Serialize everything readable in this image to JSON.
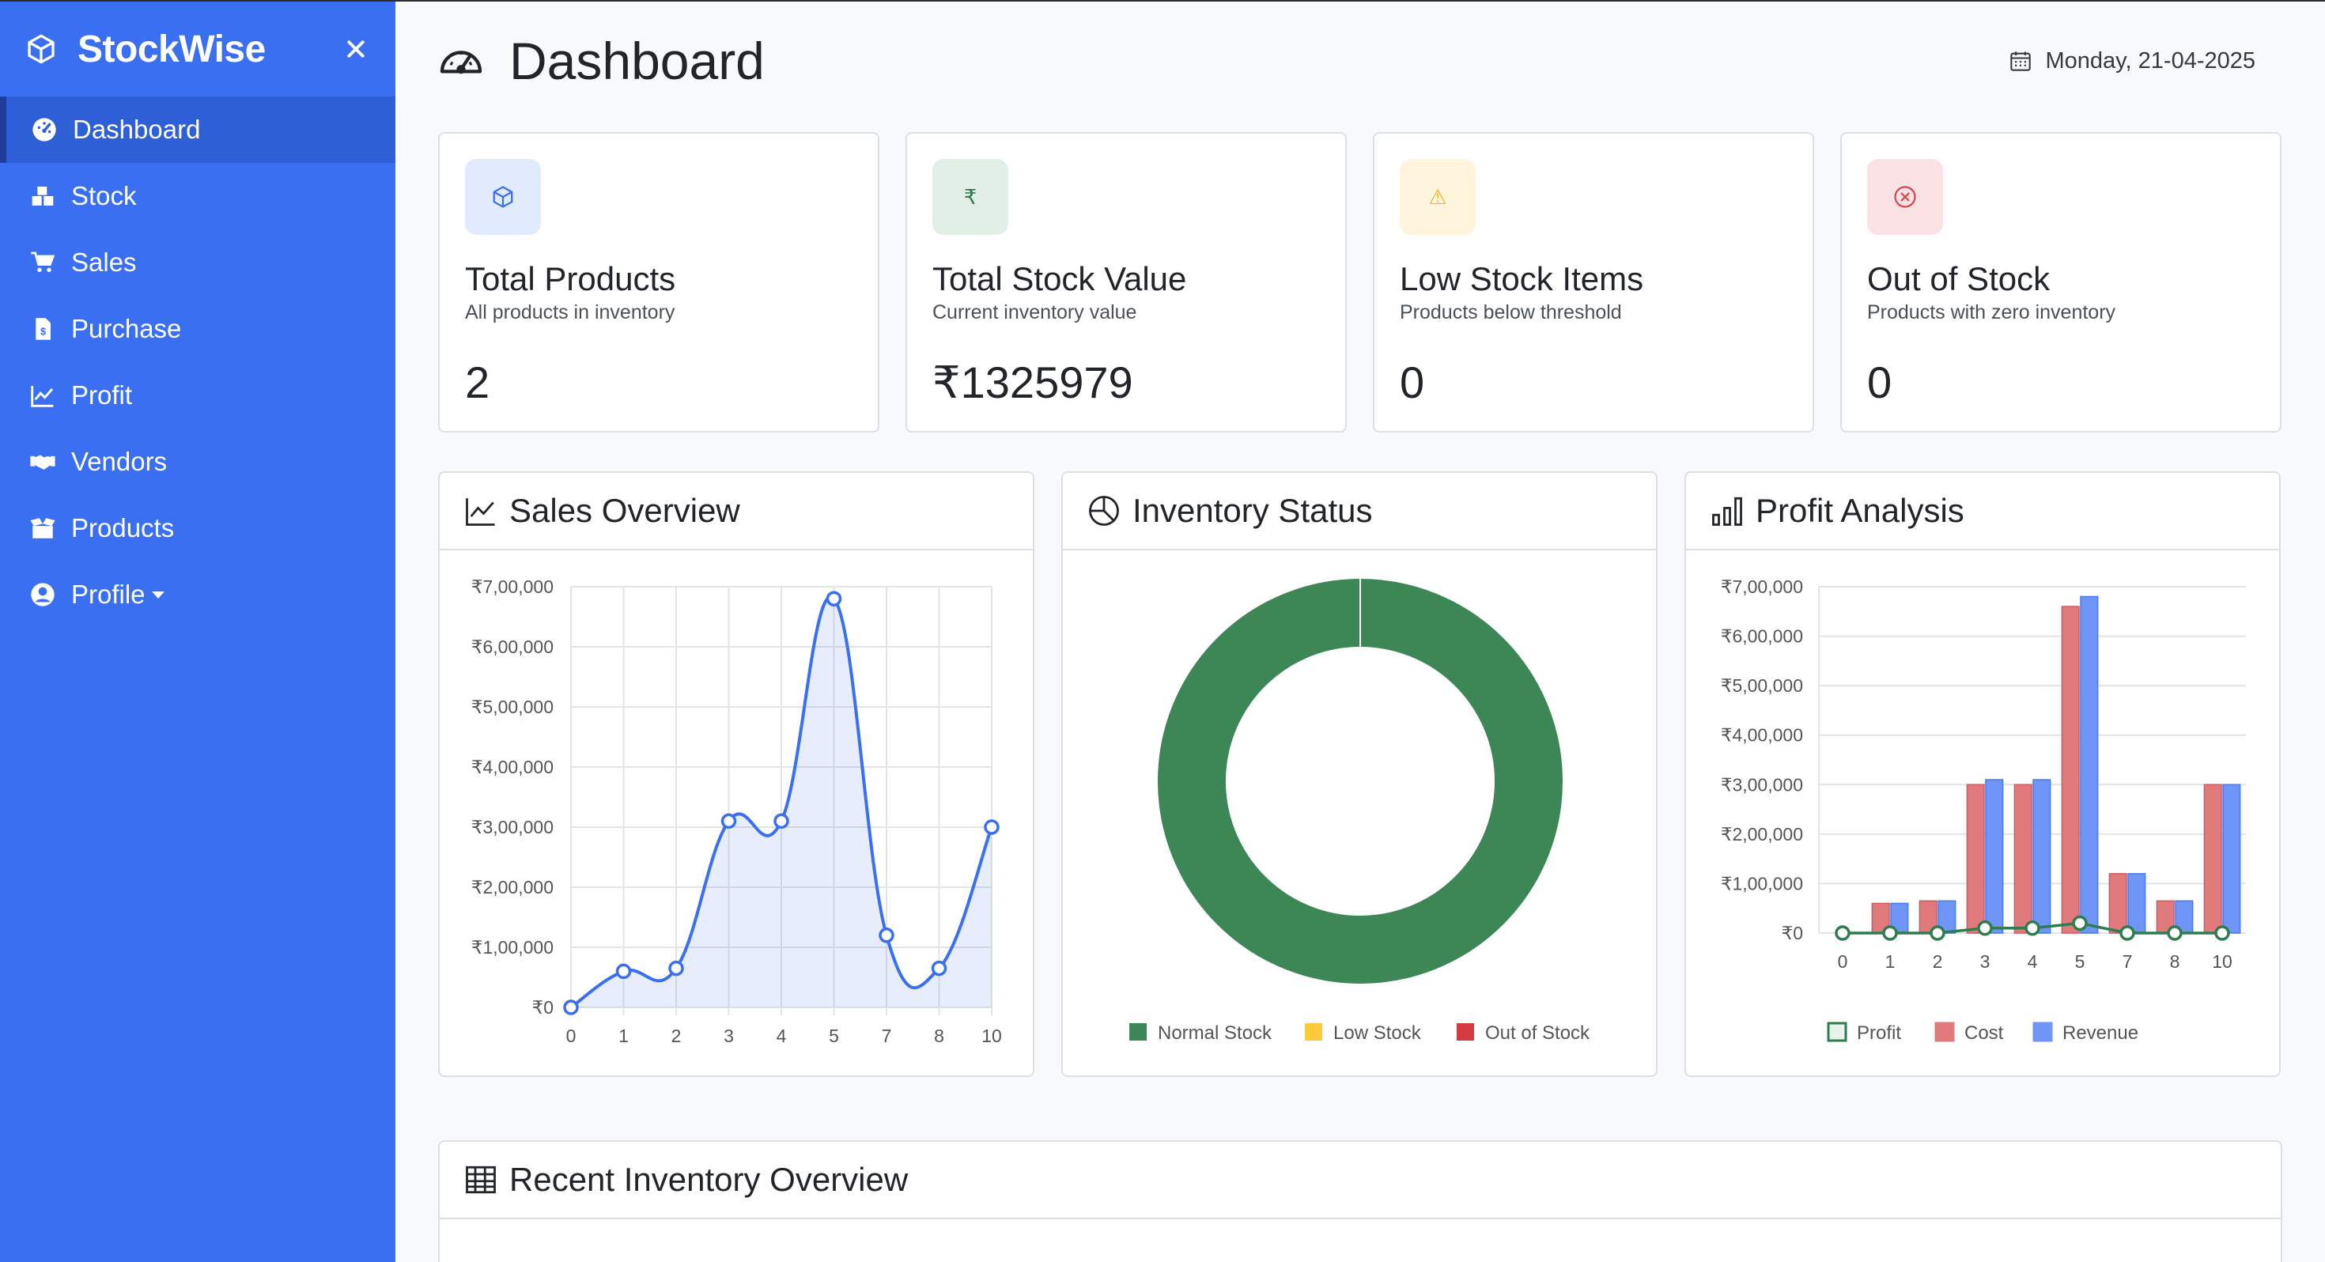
{
  "sidebar": {
    "brand": "StockWise",
    "items": [
      {
        "label": "Dashboard",
        "icon": "dashboard-icon",
        "active": true
      },
      {
        "label": "Stock",
        "icon": "boxes-icon"
      },
      {
        "label": "Sales",
        "icon": "cart-icon"
      },
      {
        "label": "Purchase",
        "icon": "invoice-icon"
      },
      {
        "label": "Profit",
        "icon": "line-chart-icon"
      },
      {
        "label": "Vendors",
        "icon": "handshake-icon"
      },
      {
        "label": "Products",
        "icon": "box-open-icon"
      },
      {
        "label": "Profile",
        "icon": "user-circle-icon"
      }
    ]
  },
  "header": {
    "title": "Dashboard",
    "date": "Monday, 21-04-2025"
  },
  "stats": [
    {
      "title": "Total Products",
      "subtitle": "All products in inventory",
      "value": "2",
      "icon": "cube-icon",
      "icon_glyph": "",
      "color": "#3a6ff2",
      "bg": "#e2ebfd"
    },
    {
      "title": "Total Stock Value",
      "subtitle": "Current inventory value",
      "value": "₹1325979",
      "icon": "rupee-icon",
      "icon_glyph": "₹",
      "color": "#2e7d4f",
      "bg": "#e1efe6"
    },
    {
      "title": "Low Stock Items",
      "subtitle": "Products below threshold",
      "value": "0",
      "icon": "warning-icon",
      "icon_glyph": "⚠",
      "color": "#f0b429",
      "bg": "#fff4dc"
    },
    {
      "title": "Out of Stock",
      "subtitle": "Products with zero inventory",
      "value": "0",
      "icon": "x-circle-icon",
      "icon_glyph": "",
      "color": "#d64550",
      "bg": "#fbe3e5"
    }
  ],
  "panels": {
    "sales": {
      "title": "Sales Overview"
    },
    "inventory": {
      "title": "Inventory Status"
    },
    "profit": {
      "title": "Profit Analysis"
    },
    "recent": {
      "title": "Recent Inventory Overview"
    }
  },
  "colors": {
    "accent": "#3a6ff2",
    "normal": "#3d8757",
    "low": "#ffc93c",
    "out": "#d43a3f",
    "cost": "#e07a7d",
    "revenue": "#6f96f7",
    "profit": "#2e7d4f"
  },
  "chart_data": [
    {
      "type": "area",
      "categories": [
        "0",
        "1",
        "2",
        "3",
        "4",
        "5",
        "7",
        "8",
        "10"
      ],
      "values": [
        0,
        60000,
        65000,
        310000,
        310000,
        680000,
        120000,
        65000,
        300000
      ],
      "ylim": [
        0,
        700000
      ],
      "yticks": [
        "₹0",
        "₹1,00,000",
        "₹2,00,000",
        "₹3,00,000",
        "₹4,00,000",
        "₹5,00,000",
        "₹6,00,000",
        "₹7,00,000"
      ],
      "grid": true
    },
    {
      "type": "pie",
      "categories": [
        "Normal Stock",
        "Low Stock",
        "Out of Stock"
      ],
      "values": [
        2,
        0,
        0
      ],
      "legend": "bottom"
    },
    {
      "type": "bar",
      "categories": [
        "0",
        "1",
        "2",
        "3",
        "4",
        "5",
        "7",
        "8",
        "10"
      ],
      "series": [
        {
          "name": "Profit",
          "type": "line",
          "values": [
            0,
            0,
            0,
            10000,
            10000,
            20000,
            0,
            0,
            0
          ]
        },
        {
          "name": "Cost",
          "values": [
            0,
            60000,
            65000,
            300000,
            300000,
            660000,
            120000,
            65000,
            300000
          ]
        },
        {
          "name": "Revenue",
          "values": [
            0,
            60000,
            65000,
            310000,
            310000,
            680000,
            120000,
            65000,
            300000
          ]
        }
      ],
      "ylim": [
        0,
        700000
      ],
      "yticks": [
        "₹0",
        "₹1,00,000",
        "₹2,00,000",
        "₹3,00,000",
        "₹4,00,000",
        "₹5,00,000",
        "₹6,00,000",
        "₹7,00,000"
      ],
      "legend": "bottom",
      "grid": true
    }
  ]
}
